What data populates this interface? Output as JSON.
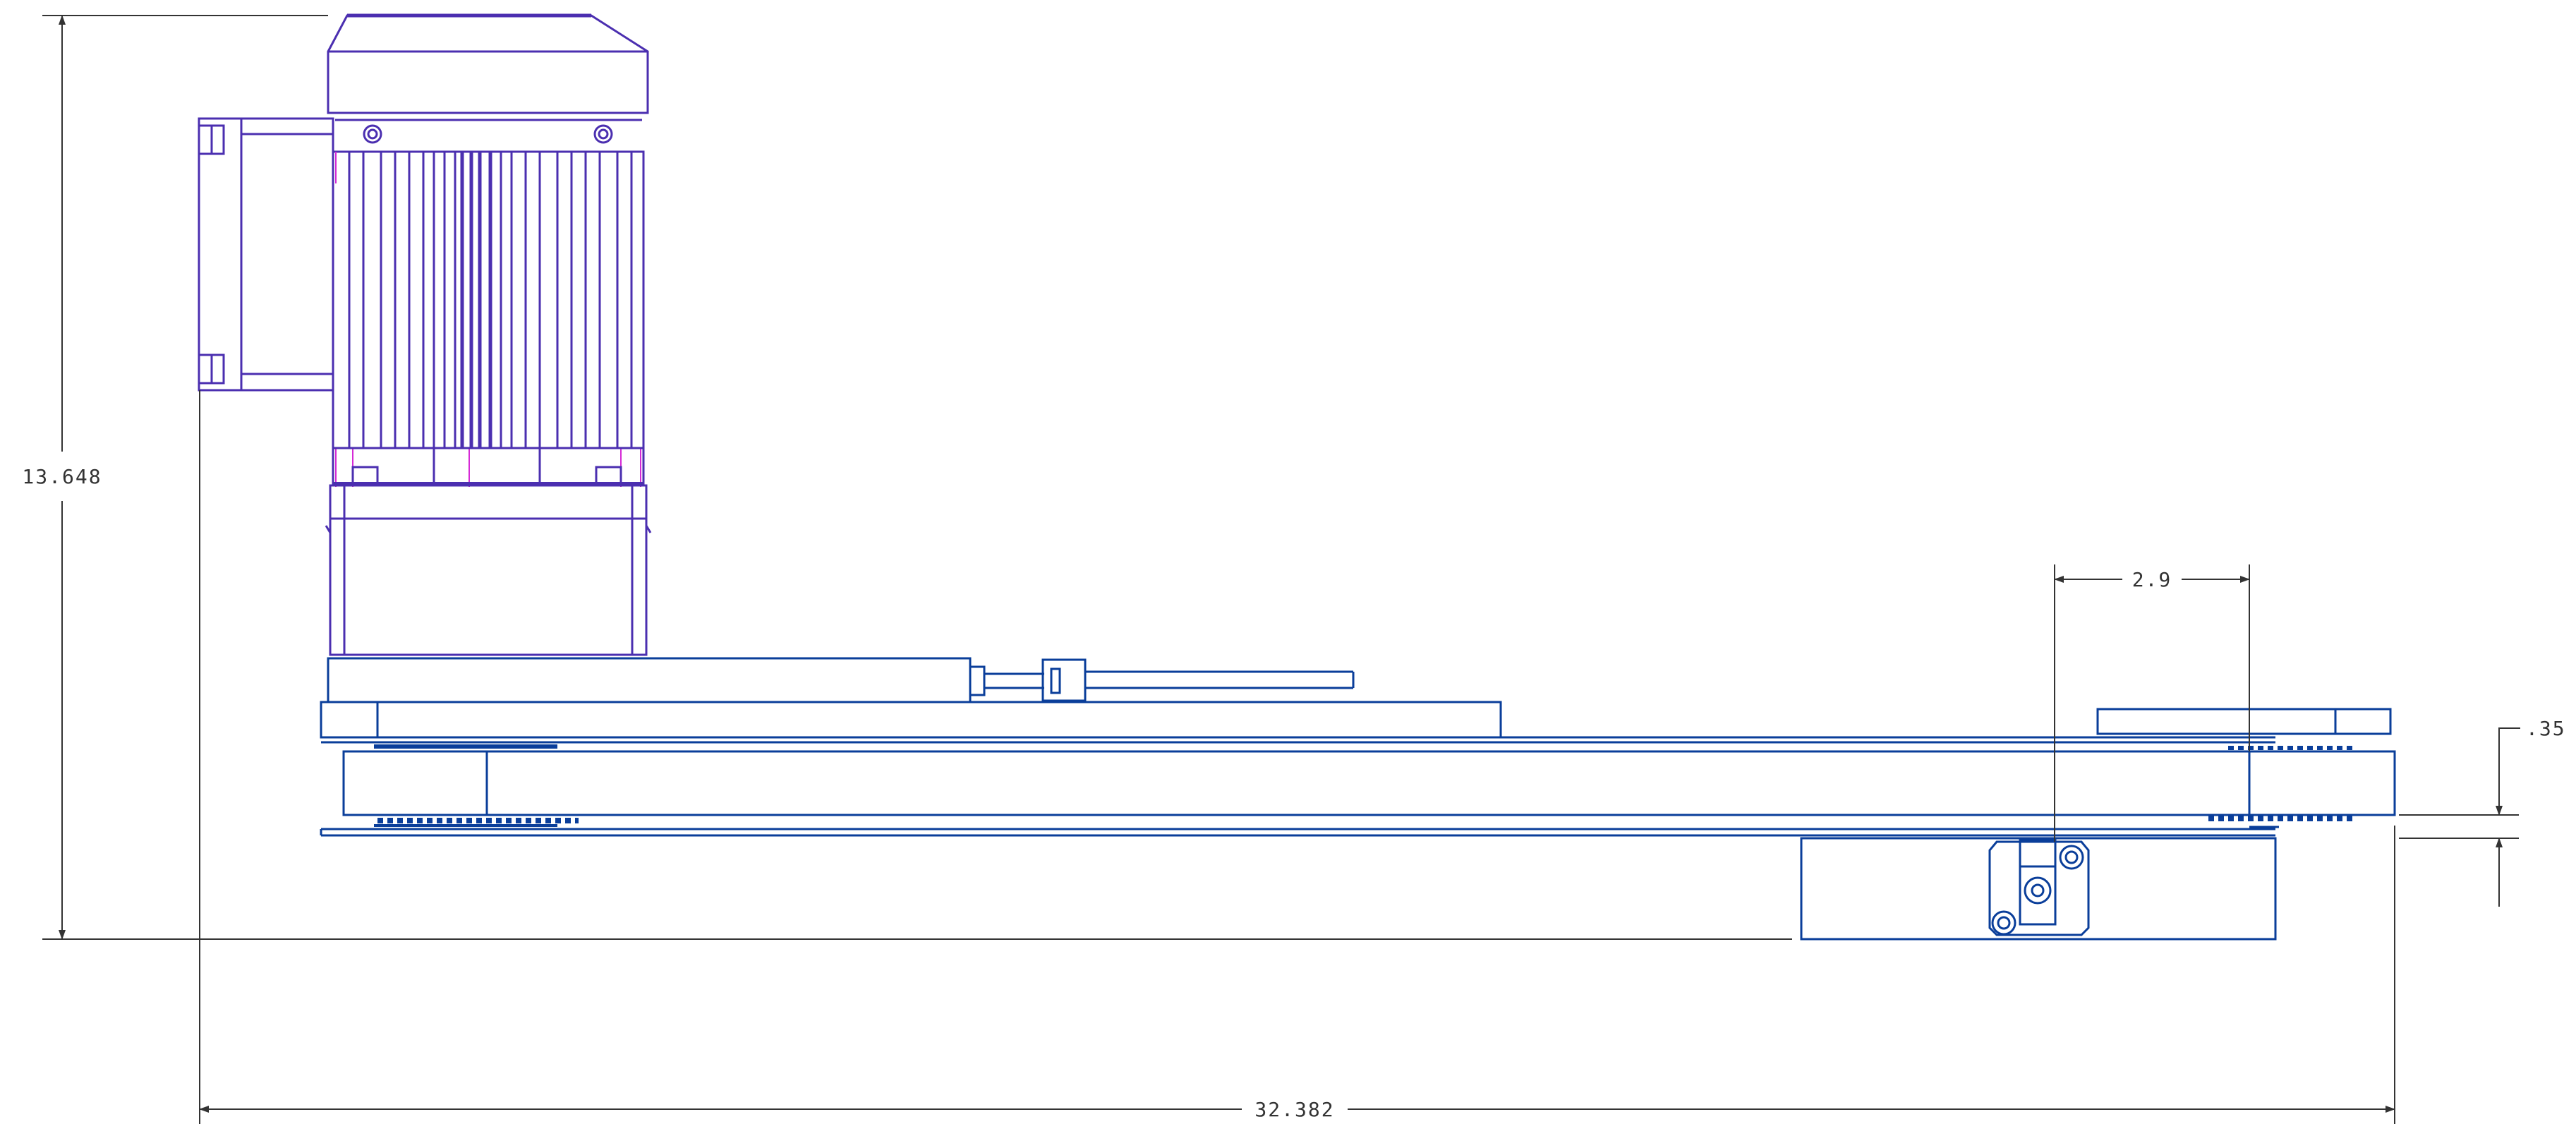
{
  "drawing": {
    "title": "",
    "colors": {
      "background": "#ffffff",
      "dimension_lines": "#333333",
      "motor_outline": "#4b2fb0",
      "motor_highlight": "#d62ad6",
      "conveyor_outline": "#0a3e9a"
    },
    "dimensions": {
      "overall_height": "13.648",
      "overall_length": "32.382",
      "offset_width": "2.9",
      "belt_thickness": ".35"
    },
    "components": [
      "motor-fan-cover",
      "motor-terminal-box",
      "motor-cooling-fins",
      "gearbox",
      "motor-mount-plate",
      "adjustment-screw",
      "conveyor-frame",
      "conveyor-belt",
      "tail-pulley",
      "drive-pulley",
      "support-bracket",
      "mounting-plate-with-bolts"
    ]
  }
}
